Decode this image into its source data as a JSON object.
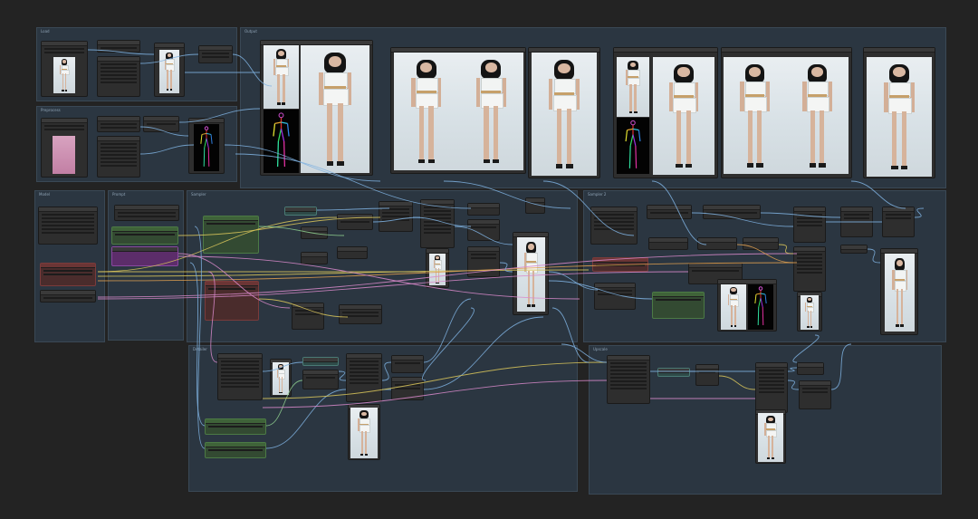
{
  "app": {
    "name": "node graph editor",
    "background": "#232323"
  },
  "groups": [
    {
      "id": "g1",
      "title": "Load"
    },
    {
      "id": "g2",
      "title": "Preprocess"
    },
    {
      "id": "g3",
      "title": "Output"
    },
    {
      "id": "g4",
      "title": "Model"
    },
    {
      "id": "g5",
      "title": "Prompt"
    },
    {
      "id": "g6",
      "title": "Sampler"
    },
    {
      "id": "g7",
      "title": "Sampler 2"
    },
    {
      "id": "g8",
      "title": "Detailer"
    },
    {
      "id": "g9",
      "title": "Upscale"
    }
  ],
  "colors": {
    "group_bg": "#2b3641",
    "node_bg": "#2e2e2e",
    "wire_blue": "#7fb2e0",
    "wire_yellow": "#d9c55a",
    "wire_pink": "#d98acb",
    "wire_orange": "#e0a050",
    "wire_green": "#8fd08f",
    "wire_purple": "#a57ad9"
  },
  "icons": [
    "pose-skeleton-icon",
    "photo-thumbnail-icon"
  ]
}
